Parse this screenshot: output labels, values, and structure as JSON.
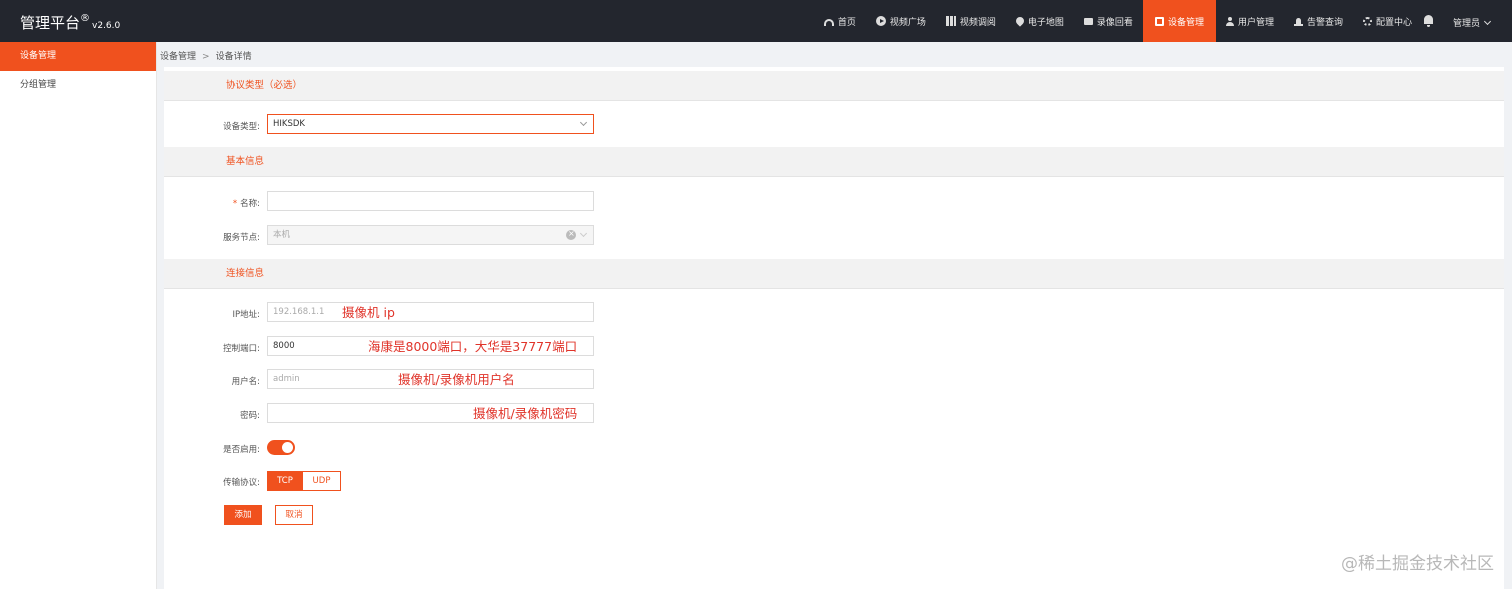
{
  "app": {
    "title": "管理平台",
    "reg": "®",
    "version": "v2.6.0"
  },
  "nav": {
    "items": [
      {
        "label": "首页",
        "icon": "dashboard-icon"
      },
      {
        "label": "视频广场",
        "icon": "play-circle-icon"
      },
      {
        "label": "视频调阅",
        "icon": "grid-icon"
      },
      {
        "label": "电子地图",
        "icon": "map-pin-icon"
      },
      {
        "label": "录像回看",
        "icon": "video-camera-icon"
      },
      {
        "label": "设备管理",
        "icon": "device-icon",
        "active": true
      },
      {
        "label": "用户管理",
        "icon": "user-icon"
      },
      {
        "label": "告警查询",
        "icon": "alarm-icon"
      },
      {
        "label": "配置中心",
        "icon": "gear-icon"
      }
    ],
    "user": "管理员"
  },
  "sidebar": {
    "items": [
      {
        "label": "设备管理",
        "active": true
      },
      {
        "label": "分组管理"
      }
    ]
  },
  "breadcrumb": {
    "root": "设备管理",
    "separator": ">",
    "current": "设备详情"
  },
  "form": {
    "section_protocol": "协议类型（必选）",
    "device_type_label": "设备类型:",
    "device_type_value": "HIKSDK",
    "section_basic": "基本信息",
    "name_required": "*",
    "name_label": "名称:",
    "name_value": "",
    "node_label": "服务节点:",
    "node_value": "本机",
    "section_conn": "连接信息",
    "ip_label": "IP地址:",
    "ip_placeholder": "192.168.1.1",
    "port_label": "控制端口:",
    "port_value": "8000",
    "username_label": "用户名:",
    "username_placeholder": "admin",
    "password_label": "密码:",
    "password_value": "",
    "enabled_label": "是否启用:",
    "enabled": true,
    "transport_label": "传输协议:",
    "transport_options": [
      "TCP",
      "UDP"
    ],
    "transport_selected": "TCP",
    "submit_label": "添加",
    "cancel_label": "取消"
  },
  "annotations": {
    "ip_note": "摄像机 ip",
    "port_note": "海康是8000端口，大华是37777端口",
    "username_note": "摄像机/录像机用户名",
    "password_note": "摄像机/录像机密码"
  },
  "watermark": "@稀土掘金技术社区",
  "colors": {
    "accent": "#f0511e",
    "topbar": "#23262e",
    "note": "#e0342a"
  }
}
